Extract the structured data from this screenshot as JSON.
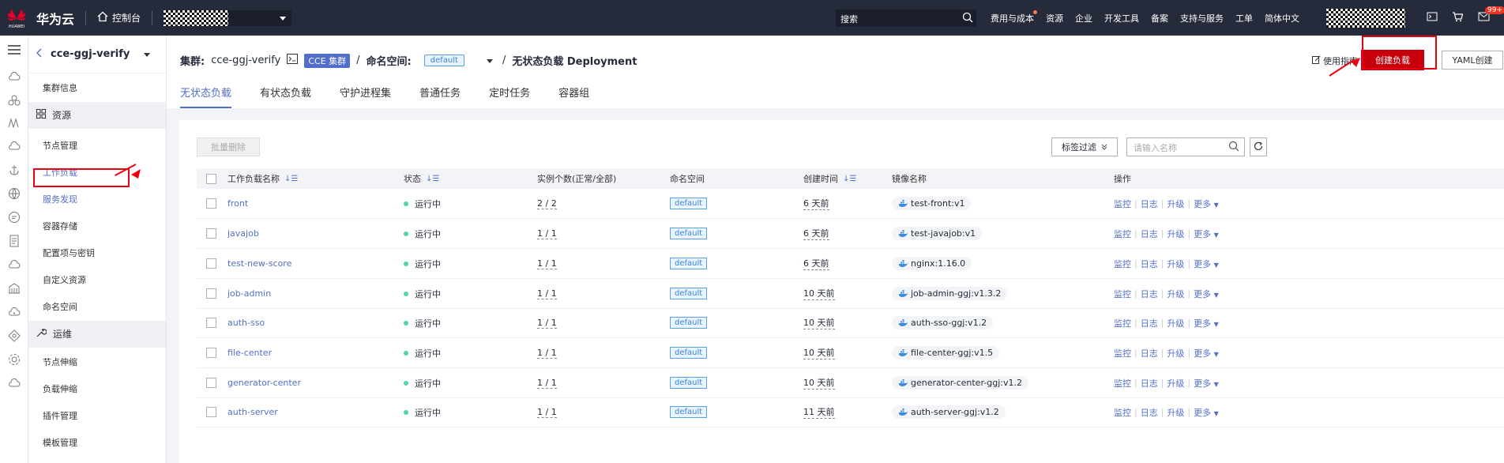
{
  "topbar": {
    "logo_text": "HUAWEI",
    "brand": "华为云",
    "console": "控制台",
    "search_placeholder": "搜索",
    "nav": [
      "费用与成本",
      "资源",
      "企业",
      "开发工具",
      "备案",
      "支持与服务",
      "工单",
      "简体中文"
    ],
    "notification_count": "99+"
  },
  "sidebar": {
    "cluster_name": "cce-ggj-verify",
    "items": [
      {
        "label": "集群信息",
        "type": "item"
      },
      {
        "label": "资源",
        "type": "group"
      },
      {
        "label": "节点管理",
        "type": "item"
      },
      {
        "label": "工作负载",
        "type": "item"
      },
      {
        "label": "服务发现",
        "type": "item"
      },
      {
        "label": "容器存储",
        "type": "item"
      },
      {
        "label": "配置项与密钥",
        "type": "item"
      },
      {
        "label": "自定义资源",
        "type": "item"
      },
      {
        "label": "命名空间",
        "type": "item"
      },
      {
        "label": "运维",
        "type": "group"
      },
      {
        "label": "节点伸缩",
        "type": "item"
      },
      {
        "label": "负载伸缩",
        "type": "item"
      },
      {
        "label": "插件管理",
        "type": "item"
      },
      {
        "label": "模板管理",
        "type": "item"
      }
    ]
  },
  "header": {
    "cluster_label": "集群:",
    "cluster_name": "cce-ggj-verify",
    "cluster_type": "CCE 集群",
    "namespace_label": "命名空间:",
    "namespace": "default",
    "page_title": "无状态负载 Deployment",
    "guide": "使用指南",
    "create_btn": "创建负载",
    "yaml_btn": "YAML创建",
    "tabs": [
      "无状态负载",
      "有状态负载",
      "守护进程集",
      "普通任务",
      "定时任务",
      "容器组"
    ]
  },
  "toolbar": {
    "bulk_delete": "批量删除",
    "tag_filter": "标签过滤",
    "search_placeholder": "请输入名称"
  },
  "table": {
    "columns": [
      "工作负载名称",
      "状态",
      "实例个数(正常/全部)",
      "命名空间",
      "创建时间",
      "镜像名称",
      "操作"
    ],
    "ops": [
      "监控",
      "日志",
      "升级",
      "更多"
    ],
    "rows": [
      {
        "name": "front",
        "status": "运行中",
        "instances": "2 / 2",
        "namespace": "default",
        "created": "6 天前",
        "image": "test-front:v1"
      },
      {
        "name": "javajob",
        "status": "运行中",
        "instances": "1 / 1",
        "namespace": "default",
        "created": "6 天前",
        "image": "test-javajob:v1"
      },
      {
        "name": "test-new-score",
        "status": "运行中",
        "instances": "1 / 1",
        "namespace": "default",
        "created": "6 天前",
        "image": "nginx:1.16.0"
      },
      {
        "name": "job-admin",
        "status": "运行中",
        "instances": "1 / 1",
        "namespace": "default",
        "created": "10 天前",
        "image": "job-admin-ggj:v1.3.2"
      },
      {
        "name": "auth-sso",
        "status": "运行中",
        "instances": "1 / 1",
        "namespace": "default",
        "created": "10 天前",
        "image": "auth-sso-ggj:v1.2"
      },
      {
        "name": "file-center",
        "status": "运行中",
        "instances": "1 / 1",
        "namespace": "default",
        "created": "10 天前",
        "image": "file-center-ggj:v1.5"
      },
      {
        "name": "generator-center",
        "status": "运行中",
        "instances": "1 / 1",
        "namespace": "default",
        "created": "10 天前",
        "image": "generator-center-ggj:v1.2"
      },
      {
        "name": "auth-server",
        "status": "运行中",
        "instances": "1 / 1",
        "namespace": "default",
        "created": "11 天前",
        "image": "auth-server-ggj:v1.2"
      }
    ]
  },
  "colors": {
    "accent": "#526ecc",
    "primary_button": "#c7000b",
    "annotation_red": "#e01",
    "status_green": "#50d4ab"
  }
}
